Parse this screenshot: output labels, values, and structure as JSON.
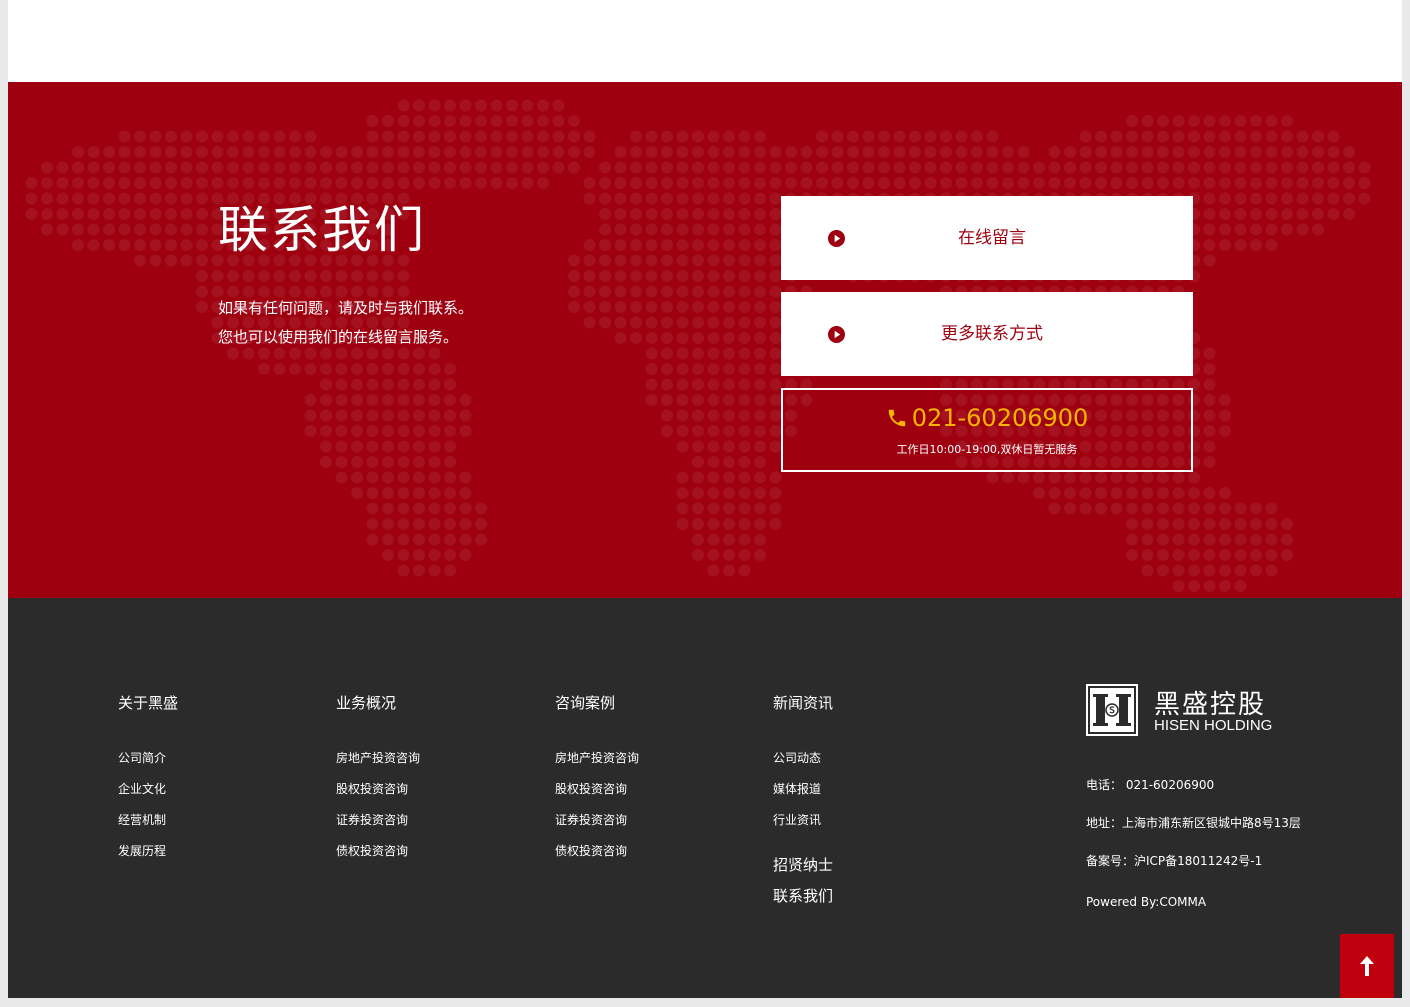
{
  "contact": {
    "title": "联系我们",
    "desc_line1": "如果有任何问题，请及时与我们联系。",
    "desc_line2": "您也可以使用我们的在线留言服务。",
    "online_message_button": "在线留言",
    "more_contact_button": "更多联系方式",
    "phone": "021-60206900",
    "hours": "工作日10:00-19:00,双休日暂无服务",
    "icons": {
      "button": "play-circle-icon",
      "phone": "phone-icon"
    },
    "colors": {
      "background": "#9e0010",
      "phone": "#f5b400"
    }
  },
  "footer": {
    "columns": [
      {
        "heading": "关于黑盛",
        "links": [
          "公司简介",
          "企业文化",
          "经营机制",
          "发展历程"
        ]
      },
      {
        "heading": "业务概况",
        "links": [
          "房地产投资咨询",
          "股权投资咨询",
          "证券投资咨询",
          "债权投资咨询"
        ]
      },
      {
        "heading": "咨询案例",
        "links": [
          "房地产投资咨询",
          "股权投资咨询",
          "证券投资咨询",
          "债权投资咨询"
        ]
      },
      {
        "heading": "新闻资讯",
        "links": [
          "公司动态",
          "媒体报道",
          "行业资讯"
        ],
        "extra": [
          "招贤纳士",
          "联系我们"
        ]
      }
    ],
    "brand": {
      "name_cn": "黑盛控股",
      "name_en": "HISEN HOLDING"
    },
    "tel": "电话：  021-60206900",
    "address": "地址：上海市浦东新区银城中路8号13层",
    "icp": "备案号：沪ICP备18011242号-1",
    "powered": "Powered By:COMMA",
    "colors": {
      "background": "#2b2b2b"
    }
  },
  "back_to_top": {
    "icon": "arrow-up-icon",
    "color": "#c1000f"
  }
}
